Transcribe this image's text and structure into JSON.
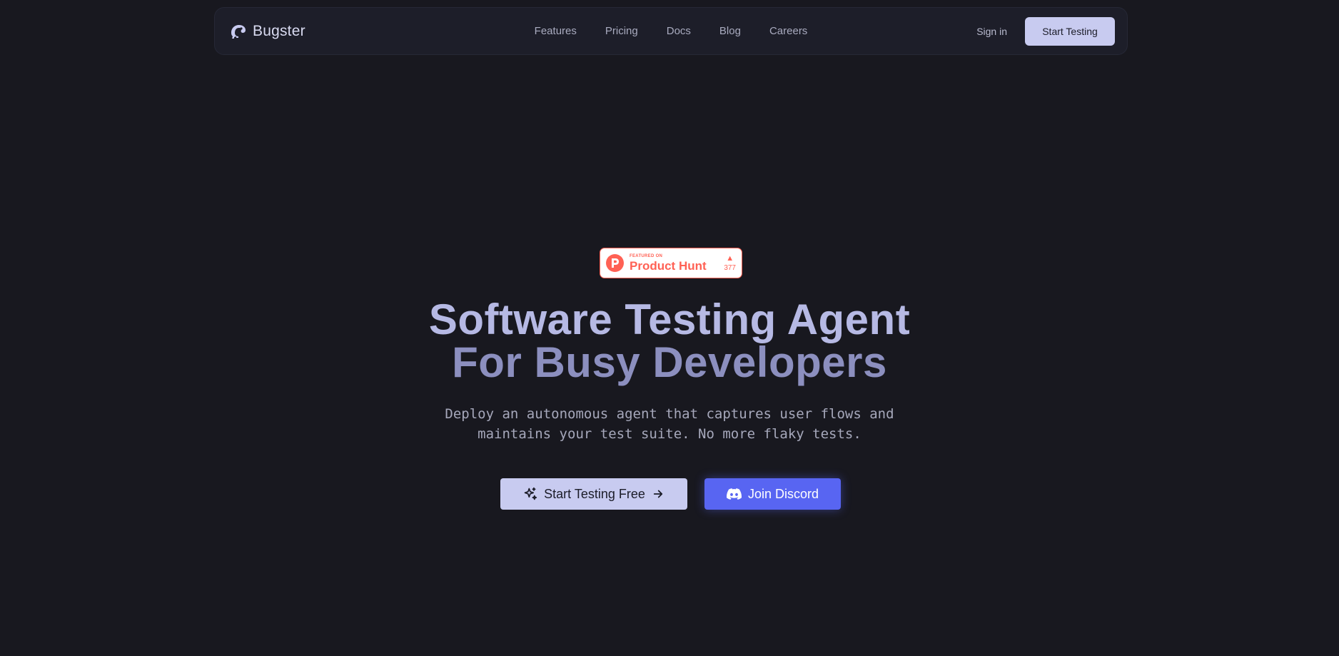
{
  "brand": {
    "name": "Bugster",
    "logo_icon": "chameleon-icon"
  },
  "nav": {
    "links": [
      "Features",
      "Pricing",
      "Docs",
      "Blog",
      "Careers"
    ],
    "sign_in": "Sign in",
    "cta": "Start Testing"
  },
  "product_hunt": {
    "featured": "FEATURED ON",
    "name": "Product Hunt",
    "logo_letter": "P",
    "votes": "377",
    "arrow": "▲"
  },
  "hero": {
    "headline_line1": "Software Testing Agent",
    "headline_line2": "For Busy Developers",
    "subtitle_line1": "Deploy an autonomous agent that captures user flows and",
    "subtitle_line2": "maintains your test suite. No more flaky tests.",
    "primary_cta": "Start Testing Free",
    "secondary_cta": "Join Discord"
  },
  "colors": {
    "background": "#18181f",
    "accent": "#c8cbf0",
    "discord": "#5865f2",
    "product_hunt": "#ff6154"
  }
}
